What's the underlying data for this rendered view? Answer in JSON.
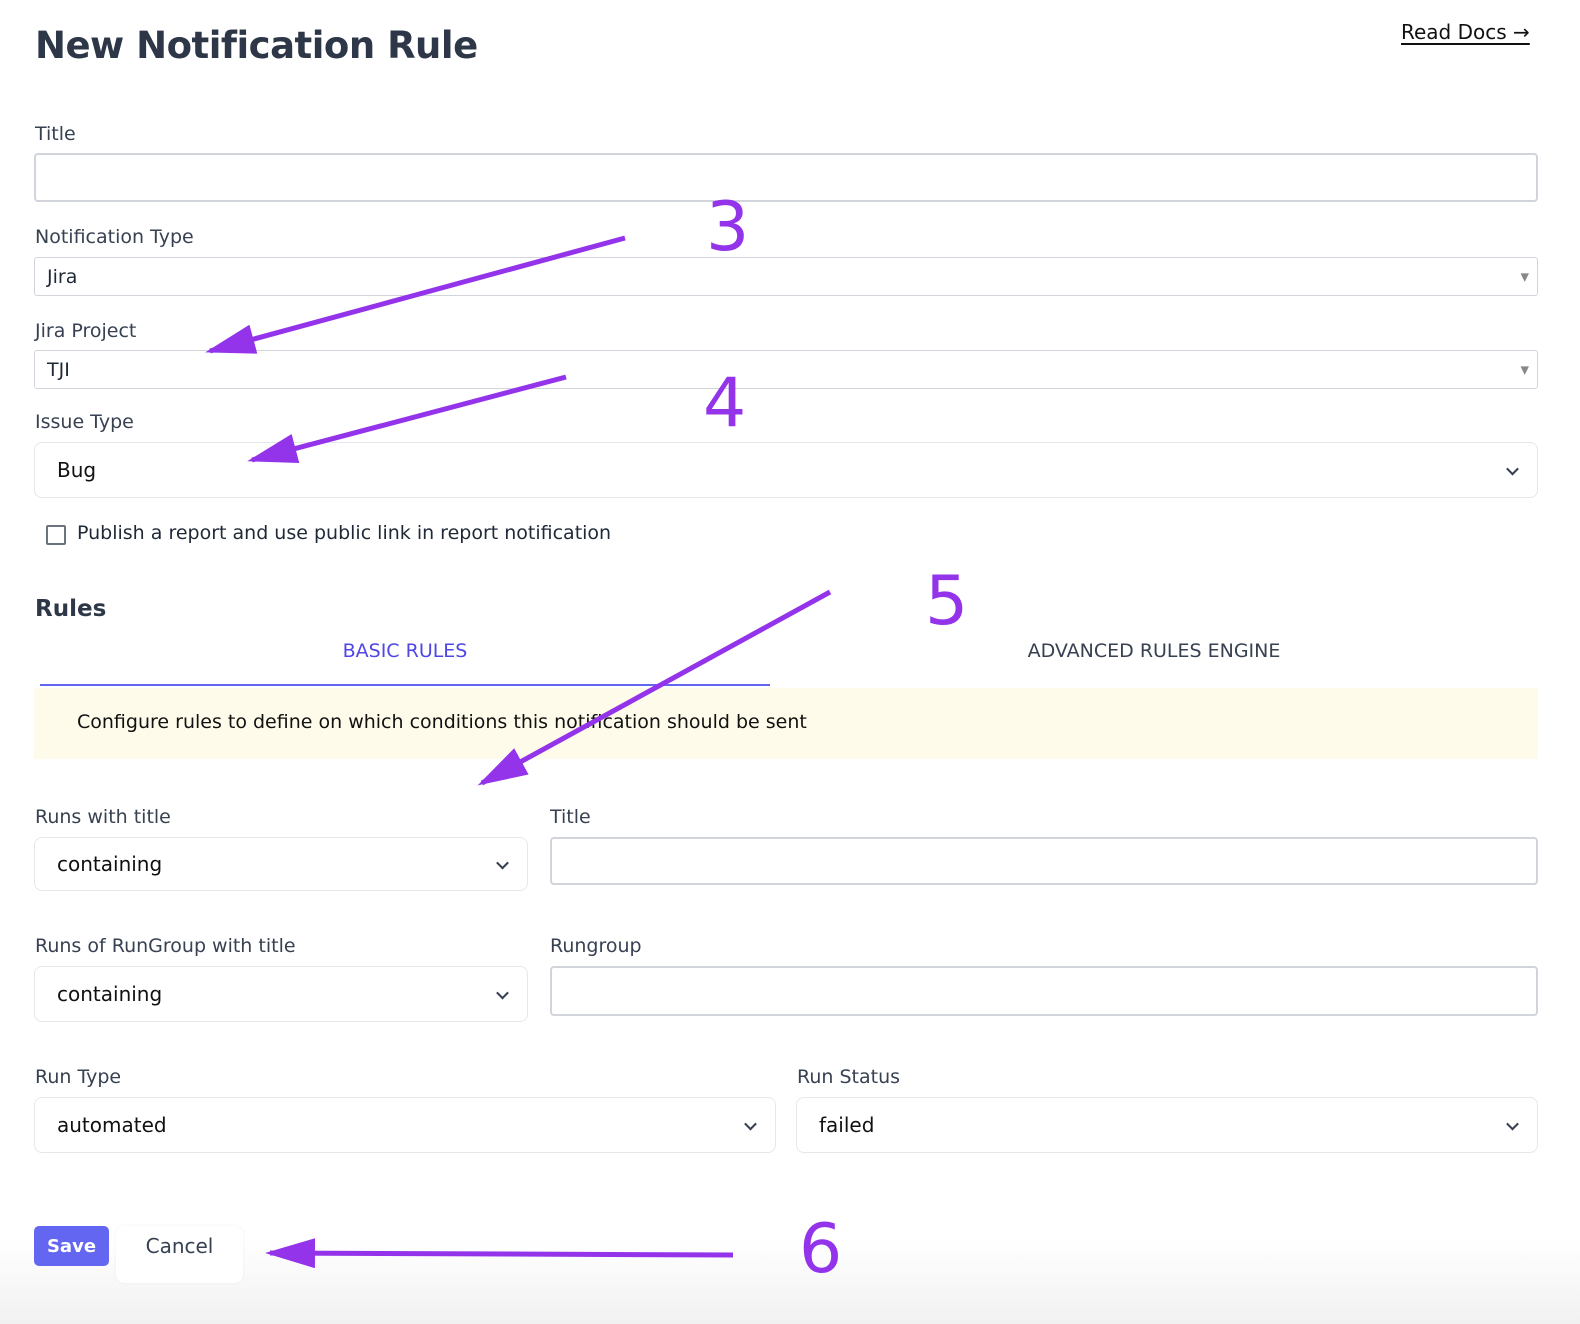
{
  "header": {
    "title": "New Notification Rule",
    "docs_link": "Read Docs →"
  },
  "form": {
    "title_label": "Title",
    "title_value": "",
    "notification_type_label": "Notification Type",
    "notification_type_value": "Jira",
    "jira_project_label": "Jira Project",
    "jira_project_value": "TJI",
    "issue_type_label": "Issue Type",
    "issue_type_value": "Bug",
    "publish_label": "Publish a report and use public link in report notification",
    "publish_checked": false
  },
  "rules": {
    "heading": "Rules",
    "tabs": [
      {
        "label": "BASIC RULES",
        "active": true
      },
      {
        "label": "ADVANCED RULES ENGINE",
        "active": false
      }
    ],
    "info": "Configure rules to define on which conditions this notification should be sent",
    "runs_title_label": "Runs with title",
    "runs_title_op": "containing",
    "title_label": "Title",
    "title_value": "",
    "rungroup_title_label": "Runs of RunGroup with title",
    "rungroup_op": "containing",
    "rungroup_label": "Rungroup",
    "rungroup_value": "",
    "run_type_label": "Run Type",
    "run_type_value": "automated",
    "run_status_label": "Run Status",
    "run_status_value": "failed"
  },
  "actions": {
    "save": "Save",
    "cancel": "Cancel"
  },
  "annotations": {
    "steps": [
      "3",
      "4",
      "5",
      "6"
    ],
    "color": "#9333ea"
  },
  "colors": {
    "accent": "#6366f1",
    "tab_active": "#4f46e5",
    "info_bg": "#fefbea"
  }
}
